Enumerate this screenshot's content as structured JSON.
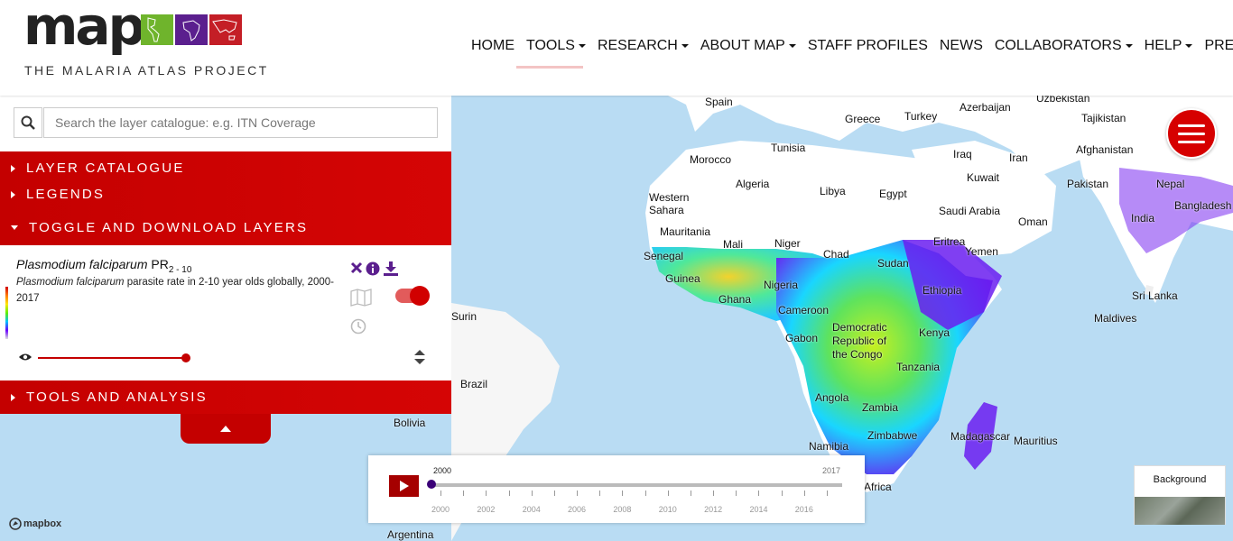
{
  "brand": {
    "wordmark": "map",
    "subtitle": "THE MALARIA ATLAS PROJECT",
    "tile_colors": [
      "#6fb42c",
      "#5b1f8e",
      "#c41e26"
    ]
  },
  "nav": {
    "items": [
      {
        "label": "HOME",
        "dropdown": false
      },
      {
        "label": "TOOLS",
        "dropdown": true
      },
      {
        "label": "RESEARCH",
        "dropdown": true
      },
      {
        "label": "ABOUT MAP",
        "dropdown": true
      },
      {
        "label": "STAFF PROFILES",
        "dropdown": false
      },
      {
        "label": "NEWS",
        "dropdown": false
      },
      {
        "label": "COLLABORATORS",
        "dropdown": true
      },
      {
        "label": "HELP",
        "dropdown": true
      },
      {
        "label": "PRESS",
        "dropdown": false
      }
    ]
  },
  "search": {
    "placeholder": "Search the layer catalogue: e.g. ITN Coverage",
    "icon": "search-icon"
  },
  "panel": {
    "layer_catalogue": "LAYER CATALOGUE",
    "legends": "LEGENDS",
    "toggle_download": "TOGGLE AND DOWNLOAD LAYERS",
    "tools_analysis": "TOOLS AND ANALYSIS"
  },
  "layer": {
    "title_italic": "Plasmodium falciparum",
    "title_plain": "PR",
    "title_sub": "2 - 10",
    "desc_italic": "Plasmodium falciparum",
    "desc_rest": "parasite rate in 2-10 year olds globally, 2000-2017",
    "visible": true,
    "opacity": 1.0,
    "accent": "#5b1f8e"
  },
  "timeline": {
    "current": "2000",
    "end": "2017",
    "ticks": [
      "2000",
      "2002",
      "2004",
      "2006",
      "2008",
      "2010",
      "2012",
      "2014",
      "2016"
    ]
  },
  "map": {
    "labels": [
      "Spain",
      "Greece",
      "Turkey",
      "Uzbekistan",
      "Azerbaijan",
      "Tajikistan",
      "Tunisia",
      "Morocco",
      "Iraq",
      "Iran",
      "Afghanistan",
      "Algeria",
      "Libya",
      "Egypt",
      "Kuwait",
      "Pakistan",
      "Nepal",
      "Western Sahara",
      "Saudi Arabia",
      "Oman",
      "India",
      "Bangladesh",
      "Mauritania",
      "Mali",
      "Niger",
      "Chad",
      "Sudan",
      "Eritrea",
      "Yemen",
      "Senegal",
      "Guinea",
      "Ghana",
      "Nigeria",
      "Ethiopia",
      "Sri Lanka",
      "Maldives",
      "Cameroon",
      "Gabon",
      "Democratic Republic of the Congo",
      "Kenya",
      "Tanzania",
      "Angola",
      "Zambia",
      "Brazil",
      "Bolivia",
      "Namibia",
      "Zimbabwe",
      "Madagascar",
      "Mauritius",
      "Africa",
      "Argentina",
      "Suriname"
    ]
  },
  "background_control": {
    "label": "Background"
  },
  "attribution": {
    "label": "mapbox"
  }
}
